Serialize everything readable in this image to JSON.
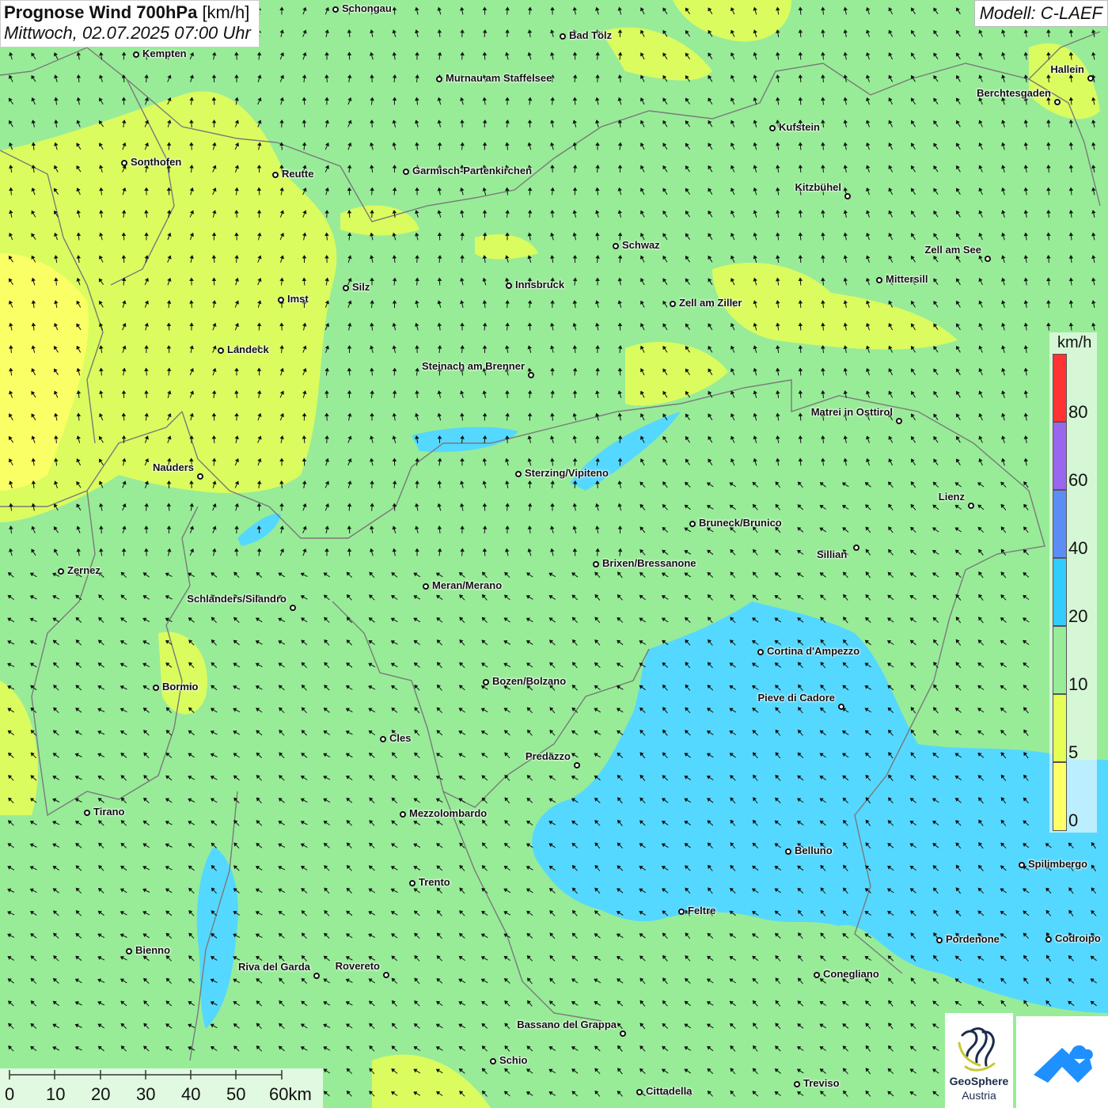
{
  "header": {
    "title": "Prognose Wind 700hPa",
    "unit": "[km/h]",
    "datetime": "Mittwoch, 02.07.2025 07:00 Uhr"
  },
  "model": "Modell: C-LAEF",
  "legend": {
    "unit": "km/h",
    "stops": [
      {
        "label": "0",
        "color": "#ffff66"
      },
      {
        "label": "5",
        "color": "#e6ff55"
      },
      {
        "label": "10",
        "color": "#98ec98"
      },
      {
        "label": "20",
        "color": "#33ccff"
      },
      {
        "label": "40",
        "color": "#5c8df5"
      },
      {
        "label": "60",
        "color": "#9966ee"
      },
      {
        "label": "80",
        "color": "#ff3333"
      }
    ]
  },
  "scale": {
    "labels": [
      "0",
      "10",
      "20",
      "30",
      "40",
      "50",
      "60km"
    ]
  },
  "colors": {
    "calm": "#ffff66",
    "light": "#e6ff55",
    "moderate": "#98ec98",
    "fresh": "#55d8ff"
  },
  "cities": [
    {
      "name": "Schongau"
    },
    {
      "name": "Bad Tölz"
    },
    {
      "name": "Kempten"
    },
    {
      "name": "Murnau am Staffelsee"
    },
    {
      "name": "Hallein"
    },
    {
      "name": "Berchtesgaden"
    },
    {
      "name": "Kufstein"
    },
    {
      "name": "Sonthofen"
    },
    {
      "name": "Reutte"
    },
    {
      "name": "Garmisch-Partenkirchen"
    },
    {
      "name": "Kitzbühel"
    },
    {
      "name": "Schwaz"
    },
    {
      "name": "Zell am See"
    },
    {
      "name": "Mittersill"
    },
    {
      "name": "Innsbruck"
    },
    {
      "name": "Silz"
    },
    {
      "name": "Imst"
    },
    {
      "name": "Zell am Ziller"
    },
    {
      "name": "Landeck"
    },
    {
      "name": "Steinach am Brenner"
    },
    {
      "name": "Matrei in Osttirol"
    },
    {
      "name": "Nauders"
    },
    {
      "name": "Sterzing/Vipiteno"
    },
    {
      "name": "Lienz"
    },
    {
      "name": "Bruneck/Brunico"
    },
    {
      "name": "Sillian"
    },
    {
      "name": "Zernez"
    },
    {
      "name": "Brixen/Bressanone"
    },
    {
      "name": "Meran/Merano"
    },
    {
      "name": "Schlanders/Silandro"
    },
    {
      "name": "Cortina d'Ampezzo"
    },
    {
      "name": "Bozen/Bolzano"
    },
    {
      "name": "Bormio"
    },
    {
      "name": "Pieve di Cadore"
    },
    {
      "name": "Cles"
    },
    {
      "name": "Predazzo"
    },
    {
      "name": "Tirano"
    },
    {
      "name": "Mezzolombardo"
    },
    {
      "name": "Belluno"
    },
    {
      "name": "Spilimbergo"
    },
    {
      "name": "Trento"
    },
    {
      "name": "Feltre"
    },
    {
      "name": "Pordenone"
    },
    {
      "name": "Codroipo"
    },
    {
      "name": "Bienno"
    },
    {
      "name": "Riva del Garda"
    },
    {
      "name": "Rovereto"
    },
    {
      "name": "Conegliano"
    },
    {
      "name": "Bassano del Grappa"
    },
    {
      "name": "Schio"
    },
    {
      "name": "Treviso"
    },
    {
      "name": "Cittadella"
    }
  ],
  "logos": {
    "geosphere": "GeoSphere",
    "geosphere_sub": "Austria",
    "icon2": "cloud-mountain-icon"
  }
}
